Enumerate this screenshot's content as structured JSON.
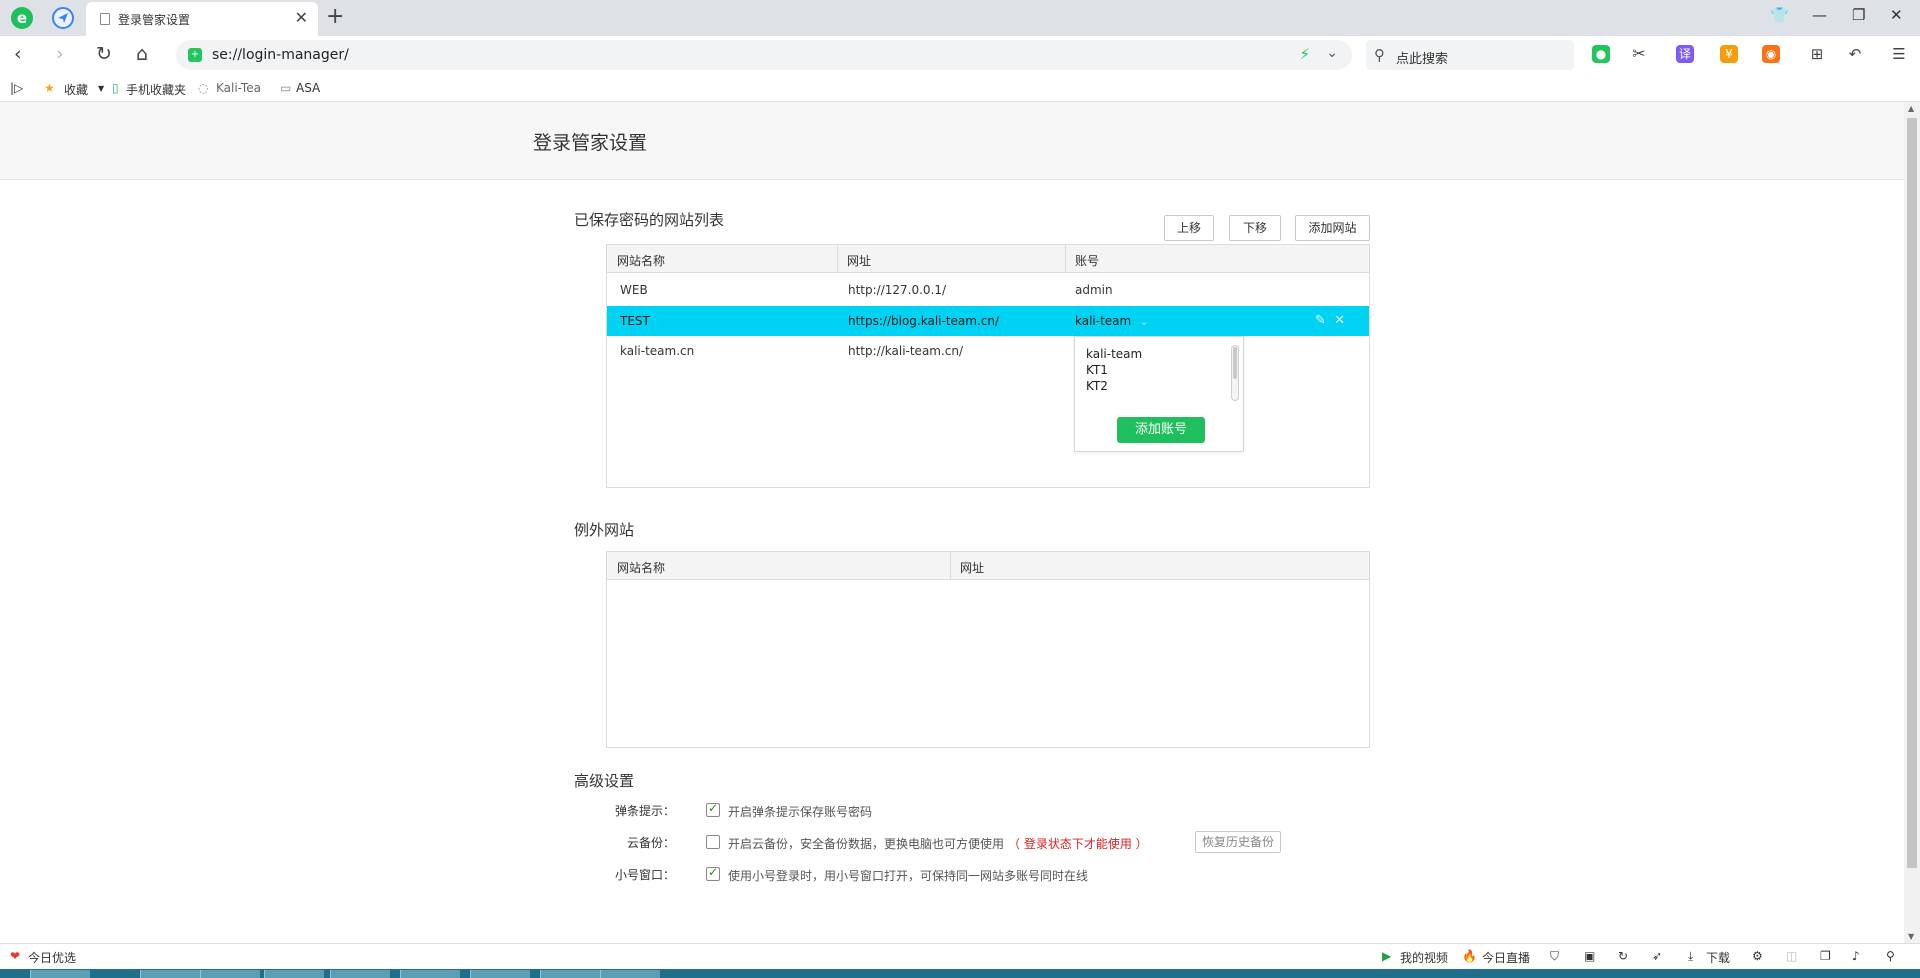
{
  "browser": {
    "tab_title": "登录管家设置",
    "tab_close": "✕",
    "new_tab": "+",
    "url": "se://login-manager/",
    "search_placeholder": "点此搜索",
    "win_controls": [
      "shirt-icon",
      "minimize-icon",
      "restore-icon",
      "close-icon"
    ],
    "toolbar_icons": [
      "back-icon",
      "forward-icon",
      "reload-icon",
      "home-icon"
    ],
    "extension_labels": {
      "translate": "译",
      "coin": "¥"
    },
    "bookmarks": [
      "收藏",
      "手机收藏夹",
      "Kali-Tea",
      "ASA"
    ]
  },
  "page": {
    "title": "登录管家设置",
    "saved_section": {
      "title": "已保存密码的网站列表",
      "buttons": {
        "move_up": "上移",
        "move_down": "下移",
        "add_site": "添加网站"
      },
      "columns": [
        "网站名称",
        "网址",
        "账号"
      ],
      "rows": [
        {
          "name": "WEB",
          "url": "http://127.0.0.1/",
          "account": "admin",
          "selected": false
        },
        {
          "name": "TEST",
          "url": "https://blog.kali-team.cn/",
          "account": "kali-team",
          "selected": true
        },
        {
          "name": "kali-team.cn",
          "url": "http://kali-team.cn/",
          "account": "",
          "selected": false
        }
      ],
      "account_dropdown": {
        "options": [
          "kali-team",
          "KT1",
          "KT2"
        ],
        "add_button": "添加账号"
      }
    },
    "exception_section": {
      "title": "例外网站",
      "columns": [
        "网站名称",
        "网址"
      ]
    },
    "advanced_section": {
      "title": "高级设置",
      "items": [
        {
          "label": "弹条提示：",
          "checked": true,
          "text": "开启弹条提示保存账号密码"
        },
        {
          "label": "云备份：",
          "checked": false,
          "text": "开启云备份，安全备份数据，更换电脑也可方便使用",
          "warn": "（ 登录状态下才能使用 ）",
          "button": "恢复历史备份"
        },
        {
          "label": "小号窗口：",
          "checked": true,
          "text": "使用小号登录时，用小号窗口打开，可保持同一网站多账号同时在线"
        }
      ]
    }
  },
  "status_bar": {
    "left": "今日优选",
    "my_video": "我的视频",
    "live": "今日直播",
    "download": "下载"
  },
  "colors": {
    "selected_row": "#00d2f4",
    "add_account_button": "#1fbf5d",
    "warning_text": "#e02020"
  }
}
